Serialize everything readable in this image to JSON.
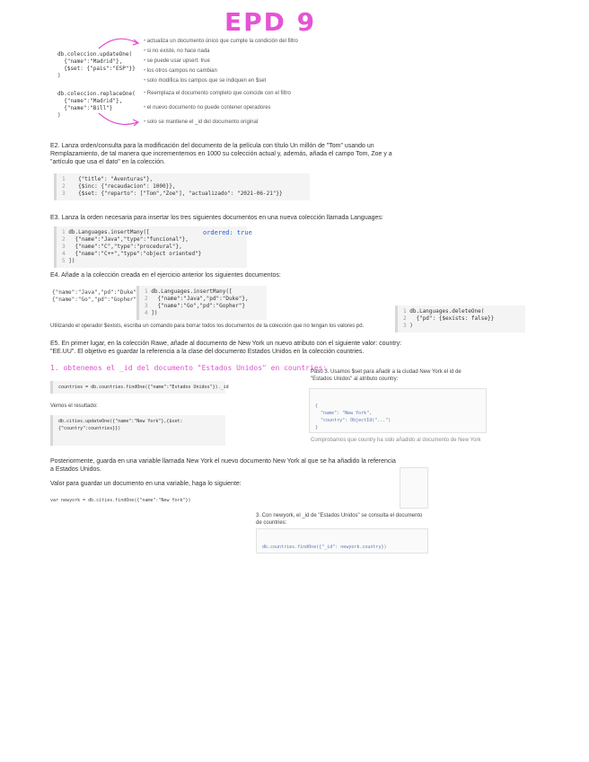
{
  "title": "EPD 9",
  "intro": {
    "update_code": "db.coleccion.updateOne(\n  {\"name\":\"Madrid\"},\n  {$set: {\"pais\":\"ESP\"}}\n)",
    "replace_code": "db.coleccion.replaceOne(\n  {\"name\":\"Madrid\"},\n  {\"name\":\"Bill\"}\n)",
    "bullets_top": [
      "actualiza un documento único que cumple la condición del filtro",
      "si no existe, no hace nada",
      "se puede usar upsert: true",
      "los otros campos no cambian",
      "solo modifica los campos que se indiquen en $set"
    ],
    "bullets_bottom": [
      "Reemplaza el documento completo que coincide con el filtro",
      "el nuevo documento no puede contener operadores",
      "solo se mantiene el _id del documento original"
    ]
  },
  "e2": {
    "text": "E2. Lanza orden/consulta para la modificación del documento de la película con título Un millón de \"Tom\" usando un Remplazamiento, de tal manera que incrementemos en 1000 su colección actual y, además, añada el campo Tom, Zoe y a \"artículo que usa el dato\" en la colección.",
    "code": [
      "  {\"title\": \"Aventuras\"},",
      "  {$inc: {\"recaudacion\": 1000}},",
      "  {$set: {\"reparto\": [\"Tom\",\"Zoe\"], \"actualizado\": \"2021-06-21\"}}"
    ]
  },
  "e3": {
    "text": "E3. Lanza la orden necesaria para insertar los tres siguientes documentos en una nueva colección llamada Languages:",
    "code": [
      "db.Languages.insertMany([",
      "  {\"name\":\"Java\",\"type\":\"funcional\"},",
      "  {\"name\":\"C\",\"type\":\"procedural\"},",
      "  {\"name\":\"C++\",\"type\":\"object oriented\"}",
      "])"
    ],
    "annotation": "ordered: true"
  },
  "e4": {
    "text": "E4. Añade a la colección creada en el ejercicio anterior los siguientes documentos:",
    "docs": "{\"name\":\"Java\",\"pd\":\"Duke\"}\n{\"name\":\"Go\",\"pd\":\"Gopher\"}",
    "code": [
      "db.Languages.insertMany([",
      "  {\"name\":\"Java\",\"pd\":\"Duke\"},",
      "  {\"name\":\"Go\",\"pd\":\"Gopher\"}",
      "])"
    ],
    "code_right": [
      "db.Languages.deleteOne(",
      "  {\"pd\": {$exists: false}}",
      ")"
    ],
    "note": "Utilizando el operador $exists, escriba un comando para borrar todos los documentos de la colección que no tengan los valores pd."
  },
  "e5": {
    "text": "E5. En primer lugar, en la colección Rawe, añade al documento de New York un nuevo atributo con el siguiente valor: country: \"EE.UU\". El objetivo es guardar la referencia a la clase del documento Estados Unidos en la colección countries.",
    "step1": "1. obtenemos el _id del documento \"Estados Unidos\" en countries:",
    "step1_code": "countries = db.countries.findOne({\"name\":\"Estados Unidos\"})._id",
    "step2_label": "Vemos el resultado:",
    "step2_code": "db.cities.updateOne({\"name\":\"New York\"},{$set:{\"country\":countries}})",
    "right_note": "Paso 3. Usamos $set para añadir a la ciudad New York el id de \"Estados Unidos\" al atributo country:",
    "right_code": [
      "{",
      "  \"name\": \"New York\",",
      "  \"country\": ObjectId(\"...\")",
      "}"
    ],
    "right_footer": "Comprobamos que country ha sido añadido al documento de New York"
  },
  "e6": {
    "text": "Posteriormente, guarda en una variable llamada New York el nuevo documento New York al que se ha añadido la referencia a Estados Unidos.",
    "var_label": "Valor para guardar un documento en una variable, haga lo siguiente:",
    "var_code": "var newyork = db.cities.findOne({\"name\":\"New York\"})",
    "step3": "3. Con newyork, el _id de \"Estados Unidos\" se consulta el documento de countries:",
    "step3_code": "db.countries.findOne({\"_id\": newyork.country})"
  }
}
